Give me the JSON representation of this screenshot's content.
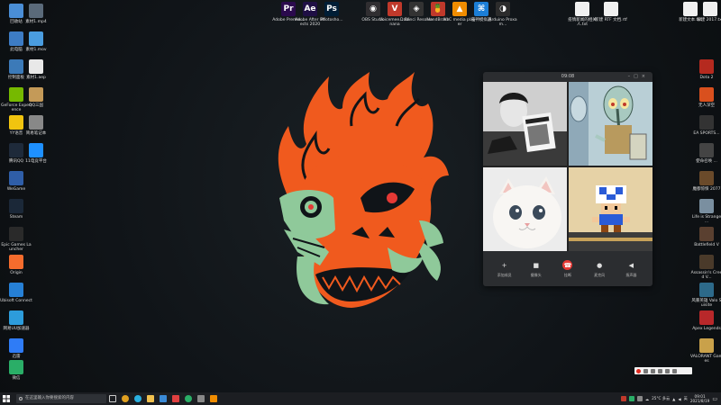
{
  "desktop_left": [
    {
      "label": "回收站",
      "icon": "recycle-bin-icon",
      "color": "#4a8ed6"
    },
    {
      "label": "素材1.mp4",
      "icon": "video-file-icon",
      "color": "#5a6a7a"
    },
    {
      "label": "此电脑",
      "icon": "computer-icon",
      "color": "#3d7cc4"
    },
    {
      "label": "素材1.mov",
      "icon": "video-file-icon",
      "color": "#4a9de0"
    },
    {
      "label": "控制面板",
      "icon": "control-panel-icon",
      "color": "#3c7ab8"
    },
    {
      "label": "素材1.aep",
      "icon": "file-icon",
      "color": "#e8e8e8"
    },
    {
      "label": "GeForce Experience",
      "icon": "geforce-icon",
      "color": "#76b900"
    },
    {
      "label": "QQ三国",
      "icon": "game-icon",
      "color": "#c49a58"
    },
    {
      "label": "YY语音",
      "icon": "yy-icon",
      "color": "#f1c40f"
    },
    {
      "label": "简易笔记本",
      "icon": "app-icon",
      "color": "#888888"
    },
    {
      "label": "腾讯QQ",
      "icon": "qq-icon",
      "color": "#1e2a3a"
    },
    {
      "label": "11电竞平台",
      "icon": "gaming-platform-icon",
      "color": "#1e90ff"
    },
    {
      "label": "WeGame",
      "icon": "wegame-icon",
      "color": "#2f5ea8"
    },
    {
      "label": "Steam",
      "icon": "steam-icon",
      "color": "#1b2838"
    },
    {
      "label": "Epic Games Launcher",
      "icon": "epic-games-icon",
      "color": "#2a2a2a"
    },
    {
      "label": "Origin",
      "icon": "origin-icon",
      "color": "#f56c2d"
    },
    {
      "label": "Ubisoft Connect",
      "icon": "ubisoft-icon",
      "color": "#2680d6"
    },
    {
      "label": "网易UU加速器",
      "icon": "uu-accelerator-icon",
      "color": "#2d9cdb"
    },
    {
      "label": "迅雷",
      "icon": "xunlei-icon",
      "color": "#2f7cf6"
    },
    {
      "label": "微信",
      "icon": "wechat-icon",
      "color": "#2aae67"
    }
  ],
  "desktop_top": [
    {
      "label": "Adobe Premie...",
      "icon": "premiere-icon",
      "color": "#2b0a4d",
      "glyph": "Pr"
    },
    {
      "label": "Adobe After Effects 2020",
      "icon": "after-effects-icon",
      "color": "#1f0f45",
      "glyph": "Ae"
    },
    {
      "label": "Photosho...",
      "icon": "photoshop-icon",
      "color": "#001e36",
      "glyph": "Ps"
    },
    {
      "label": "OBS Studio",
      "icon": "obs-icon",
      "color": "#302e31",
      "glyph": "◉"
    },
    {
      "label": "Voicemee... Banana",
      "icon": "voicemeeter-icon",
      "color": "#c0392b",
      "glyph": "V"
    },
    {
      "label": "DaVinci Resolve",
      "icon": "davinci-icon",
      "color": "#333333",
      "glyph": "◈"
    },
    {
      "label": "HandBrake",
      "icon": "handbrake-icon",
      "color": "#c0392b",
      "glyph": "🍍"
    },
    {
      "label": "VLC media player",
      "icon": "vlc-icon",
      "color": "#f08c00",
      "glyph": "▲"
    },
    {
      "label": "夜神模拟器",
      "icon": "emulator-icon",
      "color": "#1c7ed6",
      "glyph": "⌘"
    },
    {
      "label": "Arduino Proxam...",
      "icon": "arduino-icon",
      "color": "#2c2c2c",
      "glyph": "◑"
    }
  ],
  "desktop_top_right": [
    {
      "label": "疫情新闻的相关人.txt",
      "icon": "text-file-icon",
      "color": "#f0f0f0"
    },
    {
      "label": "新建 RTF 文档.rtf",
      "icon": "text-file-icon",
      "color": "#f0f0f0"
    },
    {
      "label": "新建文本.txt",
      "icon": "text-file-icon",
      "color": "#f0f0f0"
    },
    {
      "label": "新建 2017.txt",
      "icon": "text-file-icon",
      "color": "#f0f0f0"
    }
  ],
  "desktop_right": [
    {
      "label": "Dota 2",
      "icon": "dota2-icon",
      "color": "#b52a1f"
    },
    {
      "label": "无人深空",
      "icon": "game-icon",
      "color": "#d9501e"
    },
    {
      "label": "EA SPORTS...",
      "icon": "ea-icon",
      "color": "#333333"
    },
    {
      "label": "使命召唤 ...",
      "icon": "game-icon",
      "color": "#444444"
    },
    {
      "label": "魔都惊悚 2077",
      "icon": "game-icon",
      "color": "#6a4a2a"
    },
    {
      "label": "Life is Strange ...",
      "icon": "game-icon",
      "color": "#7a8fa0"
    },
    {
      "label": "Battlefield V",
      "icon": "game-icon",
      "color": "#5a4030"
    },
    {
      "label": "Assassin's Creed V...",
      "icon": "game-icon",
      "color": "#4a3a2a"
    },
    {
      "label": "风暴英雄 Valo Suisite",
      "icon": "game-icon",
      "color": "#2d6a8a"
    },
    {
      "label": "Apex Legends",
      "icon": "apex-icon",
      "color": "#b8282a"
    },
    {
      "label": "VALORANT Games",
      "icon": "valorant-icon",
      "color": "#c9a14a"
    }
  ],
  "call_window": {
    "title": "09:08",
    "toolbar": [
      {
        "label": "添加成员",
        "icon": "add-icon"
      },
      {
        "label": "摄像头",
        "icon": "camera-icon"
      },
      {
        "label": "挂断",
        "icon": "hang-up-icon"
      },
      {
        "label": "麦克风",
        "icon": "microphone-icon"
      },
      {
        "label": "扬声器",
        "icon": "speaker-icon"
      }
    ]
  },
  "taskbar": {
    "search_placeholder": "在这里输入你要搜索的内容",
    "weather": "25°C 多云",
    "clock_time": "09:01",
    "clock_date": "2021/8/19",
    "ime": "英"
  },
  "colors": {
    "demon_orange": "#f05a1e",
    "demon_green": "#8fc99a",
    "hangup_red": "#e53935"
  }
}
